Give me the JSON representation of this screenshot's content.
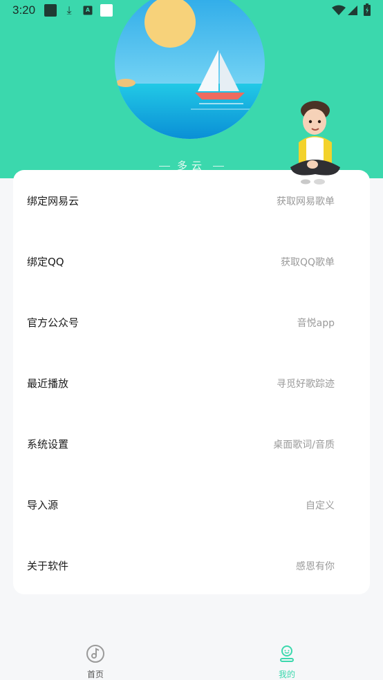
{
  "status_bar": {
    "time": "3:20",
    "icons": [
      "app-square-icon",
      "download-icon",
      "font-a-icon",
      "white-square-icon",
      "wifi-icon",
      "signal-icon",
      "battery-icon"
    ]
  },
  "header": {
    "weather_text": "多云",
    "colors": {
      "header_bg": "#3bd8ad",
      "accent": "#3bd8ad"
    }
  },
  "menu": {
    "items": [
      {
        "label": "绑定网易云",
        "value": "获取网易歌单"
      },
      {
        "label": "绑定QQ",
        "value": "获取QQ歌单"
      },
      {
        "label": "官方公众号",
        "value": "音悦app"
      },
      {
        "label": "最近播放",
        "value": "寻觅好歌踪迹"
      },
      {
        "label": "系统设置",
        "value": "桌面歌词/音质"
      },
      {
        "label": "导入源",
        "value": "自定义"
      },
      {
        "label": "关于软件",
        "value": "感恩有你"
      }
    ]
  },
  "bottom_nav": {
    "items": [
      {
        "label": "首页",
        "icon": "music-disc-icon",
        "active": false
      },
      {
        "label": "我的",
        "icon": "profile-icon",
        "active": true
      }
    ],
    "active_color": "#3bd8ad",
    "inactive_color": "#555555"
  }
}
